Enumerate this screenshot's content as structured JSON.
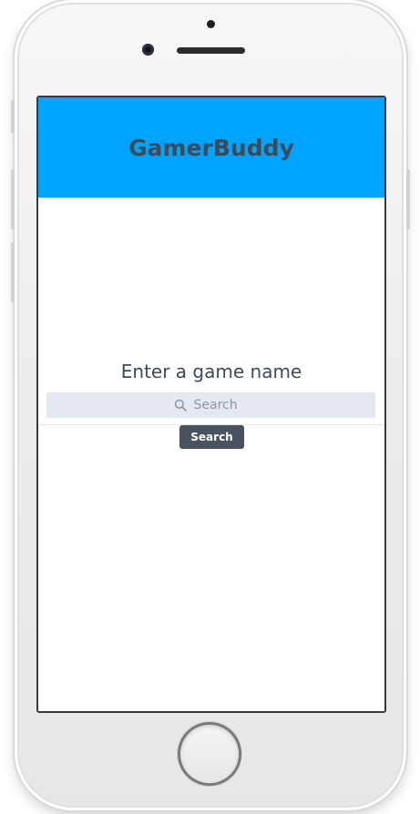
{
  "app": {
    "title": "GamerBuddy"
  },
  "main": {
    "prompt": "Enter a game name",
    "search": {
      "placeholder": "Search",
      "value": "",
      "icon": "search-icon"
    },
    "search_button_label": "Search"
  },
  "colors": {
    "header_bg": "#00a4ff",
    "title_text": "#3f4a58",
    "search_bg": "#e4e8f0",
    "button_bg": "#4a5260",
    "button_text": "#ffffff"
  }
}
